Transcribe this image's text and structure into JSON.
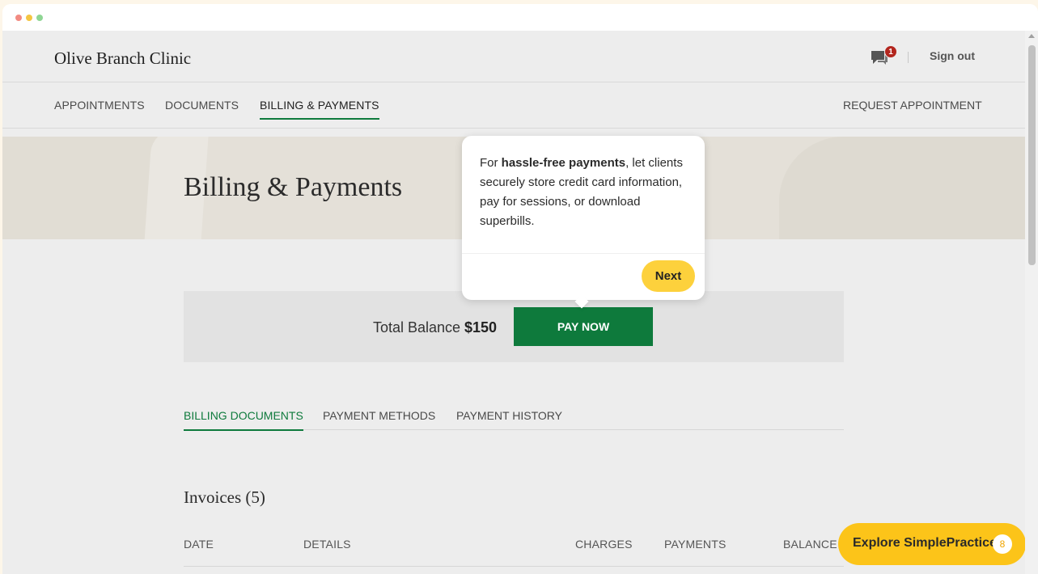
{
  "header": {
    "brand": "Olive Branch Clinic",
    "messages_badge": "1",
    "sign_out": "Sign out"
  },
  "nav": {
    "items": [
      {
        "label": "APPOINTMENTS"
      },
      {
        "label": "DOCUMENTS"
      },
      {
        "label": "BILLING & PAYMENTS"
      }
    ],
    "active": "BILLING & PAYMENTS",
    "request_appointment": "REQUEST APPOINTMENT"
  },
  "hero": {
    "title": "Billing & Payments"
  },
  "balance": {
    "label": "Total Balance",
    "amount": "$150",
    "pay_now": "PAY NOW"
  },
  "tabs": {
    "items": [
      {
        "label": "BILLING DOCUMENTS"
      },
      {
        "label": "PAYMENT METHODS"
      },
      {
        "label": "PAYMENT HISTORY"
      }
    ],
    "active": "BILLING DOCUMENTS"
  },
  "invoices": {
    "title": "Invoices (5)",
    "columns": [
      "DATE",
      "DETAILS",
      "CHARGES",
      "PAYMENTS",
      "BALANCE"
    ]
  },
  "popover": {
    "text_before": "For ",
    "text_bold": "hassle-free payments",
    "text_after": ", let clients securely store credit card information, pay for sessions, or download superbills.",
    "next": "Next"
  },
  "explore": {
    "label": "Explore SimplePractice",
    "count": "8"
  },
  "colors": {
    "brand_green": "#0e7a3c",
    "accent_yellow": "#fcc419",
    "badge_red": "#b3261e"
  },
  "icons": {
    "chat": "chat-bubble-icon"
  }
}
